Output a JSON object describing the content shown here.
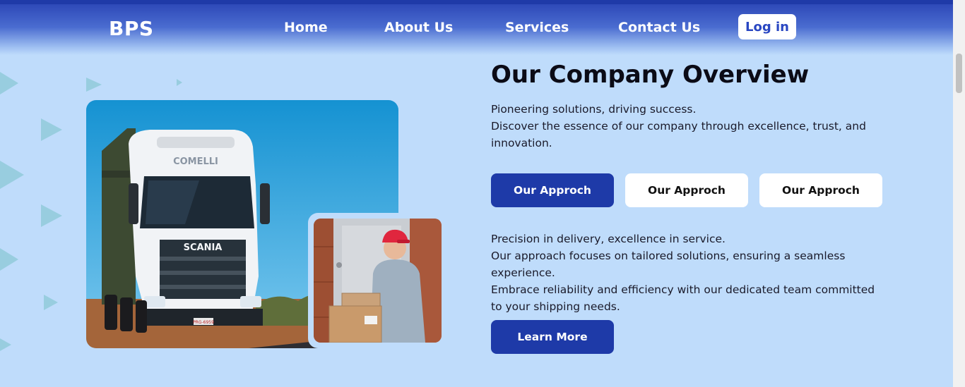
{
  "header": {
    "brand": "BPS",
    "nav": [
      "Home",
      "About Us",
      "Services",
      "Contact Us"
    ],
    "login_label": "Log in"
  },
  "colors": {
    "primary": "#1e3aa8",
    "background": "#bfdcfb",
    "decor_triangle": "#8ec9d8"
  },
  "main": {
    "title": "Our Company Overview",
    "intro": [
      "Pioneering solutions, driving success.",
      "Discover the essence of our company through excellence, trust, and innovation."
    ],
    "tabs": [
      {
        "label": "Our Approch",
        "active": true
      },
      {
        "label": "Our Approch",
        "active": false
      },
      {
        "label": "Our Approch",
        "active": false
      }
    ],
    "approach": [
      "Precision in delivery, excellence in service.",
      "Our approach focuses on tailored solutions, ensuring a seamless experience.",
      "Embrace reliability and efficiency with our dedicated team committed to your shipping needs."
    ],
    "cta_label": "Learn More"
  },
  "images": {
    "truck_brand": "SCANIA",
    "truck_cab_text": "COMELLI",
    "truck_plate": "PRG-6959"
  }
}
